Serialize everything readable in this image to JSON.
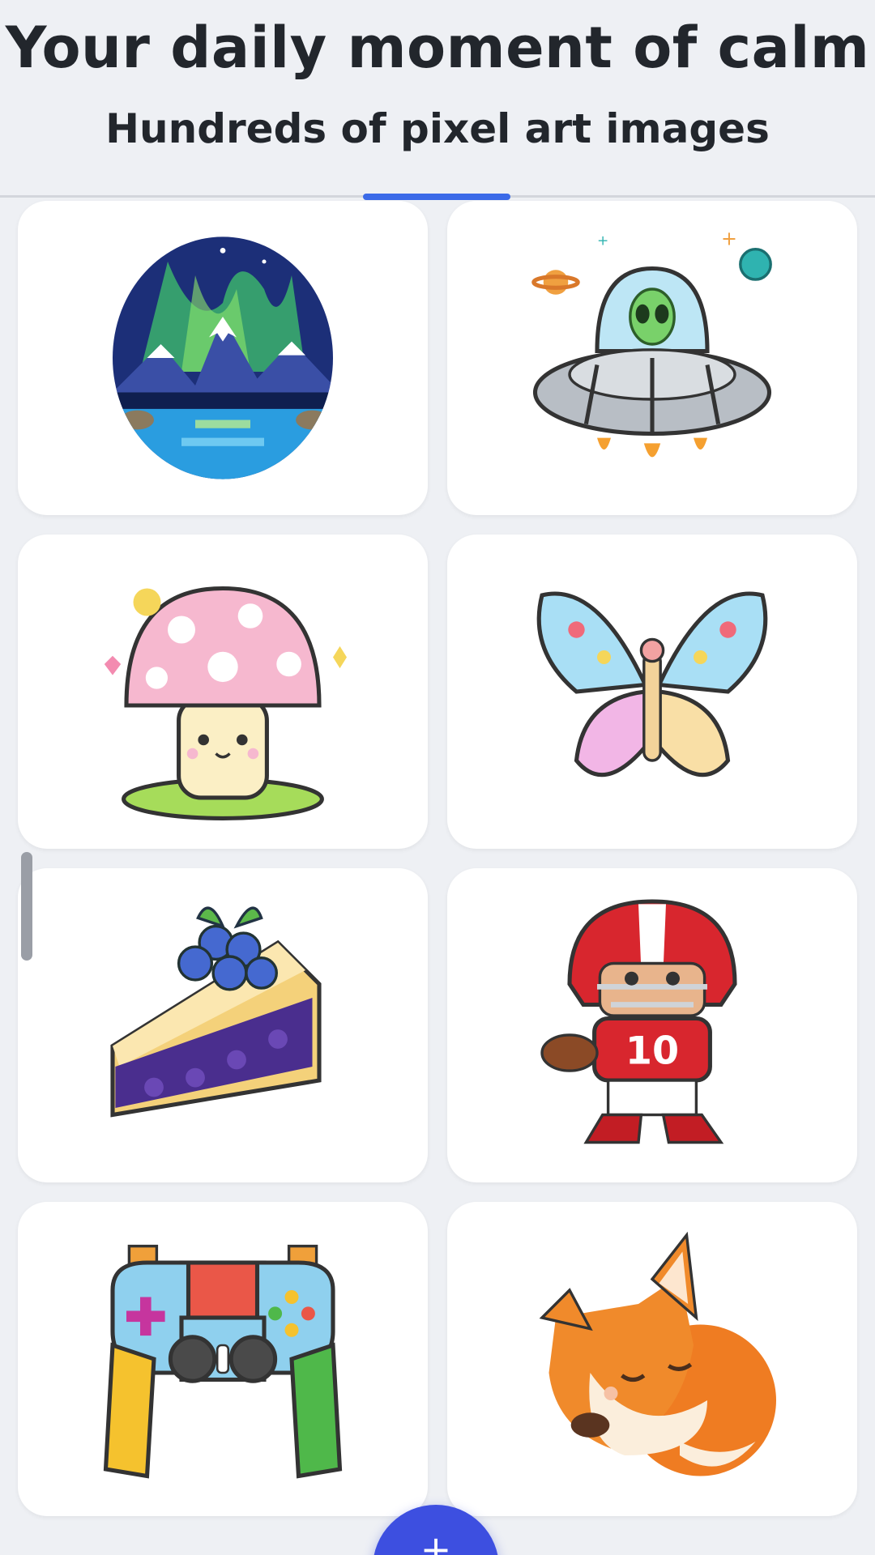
{
  "header": {
    "title": "Your daily moment of calm",
    "subtitle": "Hundreds of pixel art images"
  },
  "gallery": {
    "items": [
      {
        "name": "aurora-mountains"
      },
      {
        "name": "alien-ufo"
      },
      {
        "name": "pink-mushroom"
      },
      {
        "name": "butterfly"
      },
      {
        "name": "blueberry-pie"
      },
      {
        "name": "football-player"
      },
      {
        "name": "game-controller"
      },
      {
        "name": "sleeping-fox"
      }
    ]
  },
  "football_player": {
    "jersey_number": "10"
  },
  "colors": {
    "background": "#eef0f4",
    "accent": "#3b6ae8",
    "fab": "#3d4fe0"
  }
}
